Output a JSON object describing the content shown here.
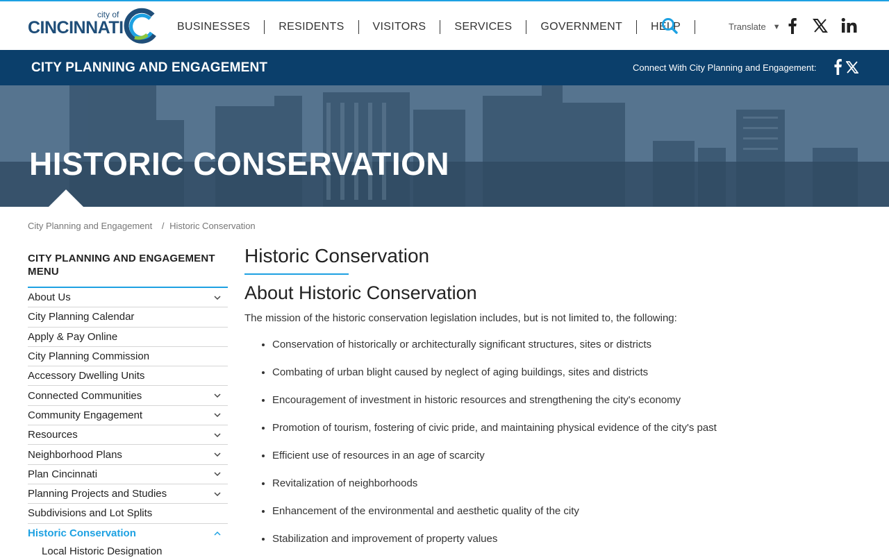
{
  "header": {
    "logo_city_of": "city of",
    "logo_name": "CINCINNATI",
    "nav": [
      "BUSINESSES",
      "RESIDENTS",
      "VISITORS",
      "SERVICES",
      "GOVERNMENT",
      "HELP"
    ],
    "translate_label": "Translate",
    "translate_arrow": "▼"
  },
  "dept_bar": {
    "title": "CITY PLANNING AND ENGAGEMENT",
    "connect_label": "Connect With City Planning and Engagement:"
  },
  "hero": {
    "title": "HISTORIC CONSERVATION"
  },
  "breadcrumb": {
    "items": [
      "City Planning and Engagement",
      "Historic Conservation"
    ],
    "separator": "/"
  },
  "sidebar": {
    "title": "CITY PLANNING AND ENGAGEMENT MENU",
    "items": [
      {
        "label": "About Us",
        "chevron": "down"
      },
      {
        "label": "City Planning Calendar",
        "chevron": ""
      },
      {
        "label": "Apply & Pay Online",
        "chevron": ""
      },
      {
        "label": "City Planning Commission",
        "chevron": ""
      },
      {
        "label": "Accessory Dwelling Units",
        "chevron": ""
      },
      {
        "label": "Connected Communities",
        "chevron": "down"
      },
      {
        "label": "Community Engagement",
        "chevron": "down"
      },
      {
        "label": "Resources",
        "chevron": "down"
      },
      {
        "label": "Neighborhood Plans",
        "chevron": "down"
      },
      {
        "label": "Plan Cincinnati",
        "chevron": "down"
      },
      {
        "label": "Planning Projects and Studies",
        "chevron": "down"
      },
      {
        "label": "Subdivisions and Lot Splits",
        "chevron": ""
      },
      {
        "label": "Historic Conservation",
        "chevron": "up",
        "active": true
      }
    ],
    "subitem": "Local Historic Designation"
  },
  "main": {
    "heading": "Historic Conservation",
    "subheading": "About Historic Conservation",
    "intro": "The mission of the historic conservation legislation includes, but is not limited to, the following:",
    "bullets": [
      "Conservation of historically or architecturally significant structures, sites or districts",
      "Combating of urban blight caused by neglect of aging buildings, sites and districts",
      "Encouragement of investment in historic resources and strengthening the city's economy",
      "Promotion of tourism, fostering of civic pride, and maintaining physical evidence of the city's past",
      "Efficient use of resources in an age of scarcity",
      "Revitalization of neighborhoods",
      "Enhancement of the environmental and aesthetic quality of the city",
      "Stabilization and improvement of property values"
    ]
  },
  "colors": {
    "accent": "#1da1e2",
    "dept_bar": "#0b3f6b",
    "logo_blue": "#1f4e79"
  },
  "icons": [
    "search-icon",
    "facebook-icon",
    "x-icon",
    "linkedin-icon",
    "chevron-down-icon",
    "chevron-up-icon"
  ]
}
